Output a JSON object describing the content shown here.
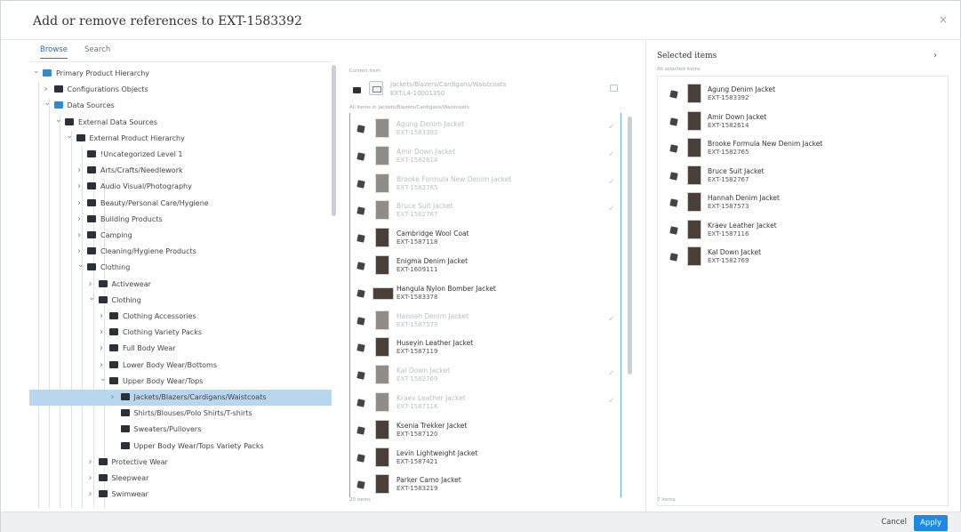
{
  "dialog": {
    "title": "Add or remove references to EXT-1583392",
    "close": "×"
  },
  "tabs": [
    {
      "label": "Browse",
      "active": true
    },
    {
      "label": "Search",
      "active": false
    }
  ],
  "tree": [
    {
      "label": "Primary Product Hierarchy",
      "level": 0,
      "expanded": true,
      "icon": "hierarchy-icon"
    },
    {
      "label": "Configurations Objects",
      "level": 1,
      "expanded": false,
      "icon": "config-icon"
    },
    {
      "label": "Data Sources",
      "level": 1,
      "expanded": true,
      "icon": "folder-icon"
    },
    {
      "label": "External Data Sources",
      "level": 2,
      "expanded": true,
      "icon": "folder-icon"
    },
    {
      "label": "External Product Hierarchy",
      "level": 3,
      "expanded": true,
      "icon": "folder-icon"
    },
    {
      "label": "!Uncategorized Level 1",
      "level": 4,
      "expanded": null,
      "icon": "folder-icon"
    },
    {
      "label": "Arts/Crafts/Needlework",
      "level": 4,
      "expanded": false,
      "icon": "folder-icon"
    },
    {
      "label": "Audio Visual/Photography",
      "level": 4,
      "expanded": false,
      "icon": "folder-icon"
    },
    {
      "label": "Beauty/Personal Care/Hygiene",
      "level": 4,
      "expanded": false,
      "icon": "folder-icon"
    },
    {
      "label": "Building Products",
      "level": 4,
      "expanded": false,
      "icon": "folder-icon"
    },
    {
      "label": "Camping",
      "level": 4,
      "expanded": false,
      "icon": "folder-icon"
    },
    {
      "label": "Cleaning/Hygiene Products",
      "level": 4,
      "expanded": false,
      "icon": "folder-icon"
    },
    {
      "label": "Clothing",
      "level": 4,
      "expanded": true,
      "icon": "folder-icon"
    },
    {
      "label": "Activewear",
      "level": 5,
      "expanded": false,
      "icon": "folder-icon"
    },
    {
      "label": "Clothing",
      "level": 5,
      "expanded": true,
      "icon": "folder-icon"
    },
    {
      "label": "Clothing Accessories",
      "level": 6,
      "expanded": false,
      "icon": "folder-icon"
    },
    {
      "label": "Clothing Variety Packs",
      "level": 6,
      "expanded": false,
      "icon": "folder-icon"
    },
    {
      "label": "Full Body Wear",
      "level": 6,
      "expanded": false,
      "icon": "folder-icon"
    },
    {
      "label": "Lower Body Wear/Bottoms",
      "level": 6,
      "expanded": false,
      "icon": "folder-icon"
    },
    {
      "label": "Upper Body Wear/Tops",
      "level": 6,
      "expanded": true,
      "icon": "folder-icon"
    },
    {
      "label": "Jackets/Blazers/Cardigans/Waistcoats",
      "level": 7,
      "expanded": false,
      "icon": "folder-icon",
      "selected": true
    },
    {
      "label": "Shirts/Blouses/Polo Shirts/T-shirts",
      "level": 7,
      "expanded": null,
      "icon": "folder-icon"
    },
    {
      "label": "Sweaters/Pullovers",
      "level": 7,
      "expanded": null,
      "icon": "folder-icon"
    },
    {
      "label": "Upper Body Wear/Tops Variety Packs",
      "level": 7,
      "expanded": null,
      "icon": "folder-icon"
    },
    {
      "label": "Protective Wear",
      "level": 5,
      "expanded": false,
      "icon": "folder-icon"
    },
    {
      "label": "Sleepwear",
      "level": 5,
      "expanded": false,
      "icon": "folder-icon"
    },
    {
      "label": "Swimwear",
      "level": 5,
      "expanded": false,
      "icon": "folder-icon"
    }
  ],
  "current": {
    "label": "Current item",
    "title": "Jackets/Blazers/Cardigans/Waistcoats",
    "id": "EXT.L4-10001350"
  },
  "items_label": "All items in Jackets/Blazers/Cardigans/Waistcoats",
  "items": [
    {
      "name": "Agung Denim Jacket",
      "id": "EXT-1583392",
      "selected": true
    },
    {
      "name": "Amir Down Jacket",
      "id": "EXT-1582614",
      "selected": true
    },
    {
      "name": "Brooke Formula New Denim Jacket",
      "id": "EXT-1582765",
      "selected": true
    },
    {
      "name": "Bruce Suit Jacket",
      "id": "EXT-1582767",
      "selected": true
    },
    {
      "name": "Cambridge Wool Coat",
      "id": "EXT-1587118",
      "selected": false
    },
    {
      "name": "Enigma Denim Jacket",
      "id": "EXT-1609111",
      "selected": false
    },
    {
      "name": "Hangula Nylon Bomber Jacket",
      "id": "EXT-1583378",
      "selected": false,
      "wide": true
    },
    {
      "name": "Hannah Denim Jacket",
      "id": "EXT-1587573",
      "selected": true
    },
    {
      "name": "Huseyin Leather Jacket",
      "id": "EXT-1587119",
      "selected": false
    },
    {
      "name": "Kal Down Jacket",
      "id": "EXT-1582769",
      "selected": true
    },
    {
      "name": "Kraev Leather Jacket",
      "id": "EXT-1587116",
      "selected": true
    },
    {
      "name": "Ksenia Trekker Jacket",
      "id": "EXT-1587120",
      "selected": false
    },
    {
      "name": "Levin Lightweight Jacket",
      "id": "EXT-1587421",
      "selected": false
    },
    {
      "name": "Parker Camo Jacket",
      "id": "EXT-1583219",
      "selected": false
    }
  ],
  "items_count": "20 items",
  "selected_panel": {
    "title": "Selected items",
    "label": "All selected items",
    "count": "7 items",
    "items": [
      {
        "name": "Agung Denim Jacket",
        "id": "EXT-1583392"
      },
      {
        "name": "Amir Down Jacket",
        "id": "EXT-1582614"
      },
      {
        "name": "Brooke Formula New Denim Jacket",
        "id": "EXT-1582765"
      },
      {
        "name": "Bruce Suit Jacket",
        "id": "EXT-1582767"
      },
      {
        "name": "Hannah Denim Jacket",
        "id": "EXT-1587573"
      },
      {
        "name": "Kraev Leather Jacket",
        "id": "EXT-1587116"
      },
      {
        "name": "Kal Down Jacket",
        "id": "EXT-1582769"
      }
    ]
  },
  "footer": {
    "cancel": "Cancel",
    "apply": "Apply"
  },
  "colors": {
    "accent": "#1e88e5",
    "selected_row": "#b7d7ee",
    "tab_underline": "#d53c2f"
  }
}
